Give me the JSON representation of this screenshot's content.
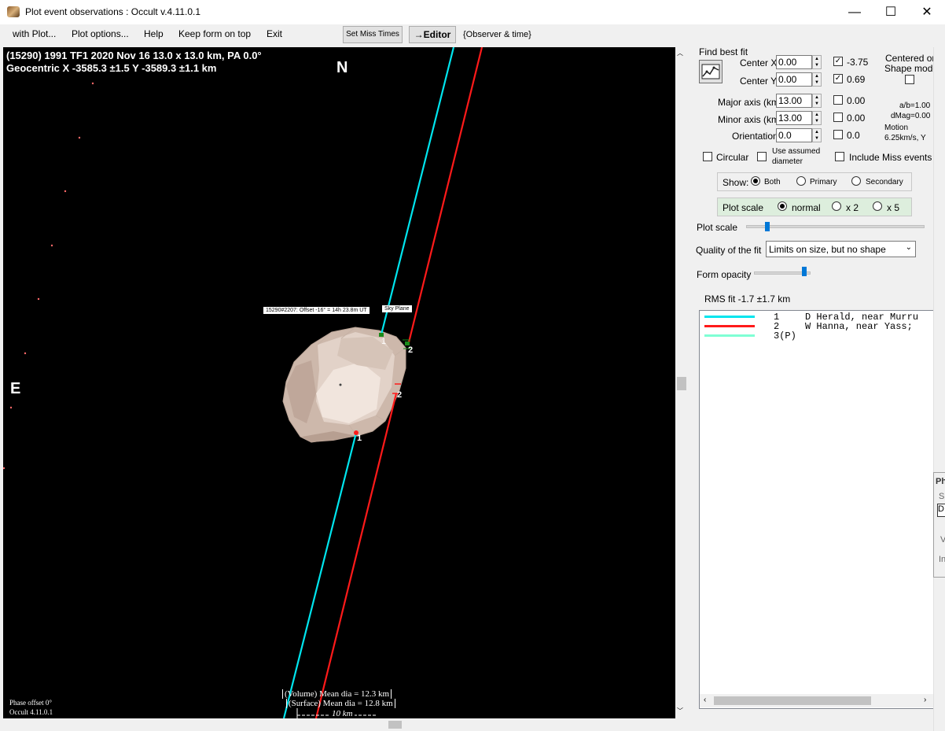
{
  "window": {
    "title": "Plot event observations : Occult v.4.11.0.1",
    "minimize": "—",
    "maximize": "☐",
    "close": "✕"
  },
  "menu": {
    "with_plot": "with Plot...",
    "plot_options": "Plot options...",
    "help": "Help",
    "keep_on_top": "Keep form on top",
    "exit": "Exit",
    "set_miss_times": "Set Miss Times",
    "editor": "→Editor",
    "observer_time": "{Observer & time}"
  },
  "plot": {
    "header_line1": "(15290) 1991 TF1  2020 Nov 16  13.0 x 13.0 km, PA 0.0°",
    "header_line2": "Geocentric  X  -3585.3 ±1.5  Y -3589.3 ±1.1 km",
    "north": "N",
    "east": "E",
    "offset_label": "15290#2207:  Offset -16° = 14h 23.8m UT",
    "sky_plane": "Sky Plane",
    "chord1_top": "1",
    "chord2_top": "2",
    "chord2_bottom": "2",
    "chord1_bottom": "1",
    "volume_dia": "(Volume) Mean dia = 12.3 km",
    "surface_dia": "(Surface) Mean dia = 12.8 km",
    "scale_bar": "10 km",
    "phase_offset": "Phase offset 0°",
    "version": "Occult 4.11.0.1",
    "colors": {
      "chord1": "#00e5ee",
      "chord2": "#ff1a1a",
      "shape": "#d8c6bb"
    }
  },
  "fit": {
    "find_best_fit": "Find best fit",
    "center_x_label": "Center X",
    "center_x": "0.00",
    "center_x_fit": "-3.75",
    "center_y_label": "Center Y",
    "center_y": "0.00",
    "center_y_fit": "0.69",
    "centered_on": "Centered on",
    "shape_model": "Shape model",
    "major_label": "Major axis (km)",
    "major": "13.00",
    "major_fit": "0.00",
    "minor_label": "Minor axis (km)",
    "minor": "13.00",
    "minor_fit": "0.00",
    "orient_label": "Orientation",
    "orient": "0.0",
    "orient_fit": "0.0",
    "ab_ratio": "a/b=1.00",
    "dmag": "dMag=0.00",
    "motion_label": "Motion",
    "motion": "6.25km/s, Y",
    "circular": "Circular",
    "use_assumed": "Use assumed",
    "diameter": "diameter",
    "include_miss": "Include Miss events",
    "show_label": "Show:",
    "show_both": "Both",
    "show_primary": "Primary",
    "show_secondary": "Secondary",
    "plot_scale_label": "Plot scale",
    "scale_normal": "normal",
    "scale_x2": "x 2",
    "scale_x5": "x 5",
    "plot_scale_slider_label": "Plot scale",
    "quality_label": "Quality of the fit",
    "quality_value": "Limits on size, but no shape",
    "opacity_label": "Form opacity",
    "rms": "RMS fit -1.7 ±1.7 km"
  },
  "observers": [
    {
      "num": "1",
      "name": "D Herald, near Murru",
      "color": "#00e5ee"
    },
    {
      "num": "2",
      "name": "W Hanna, near Yass;",
      "color": "#ff1a1a"
    },
    {
      "num": "3(P)",
      "name": "",
      "color": "#7fffd4"
    }
  ],
  "side_peek": {
    "a": "Ph",
    "b": "S",
    "c": "D",
    "d": "V",
    "e": "In"
  }
}
